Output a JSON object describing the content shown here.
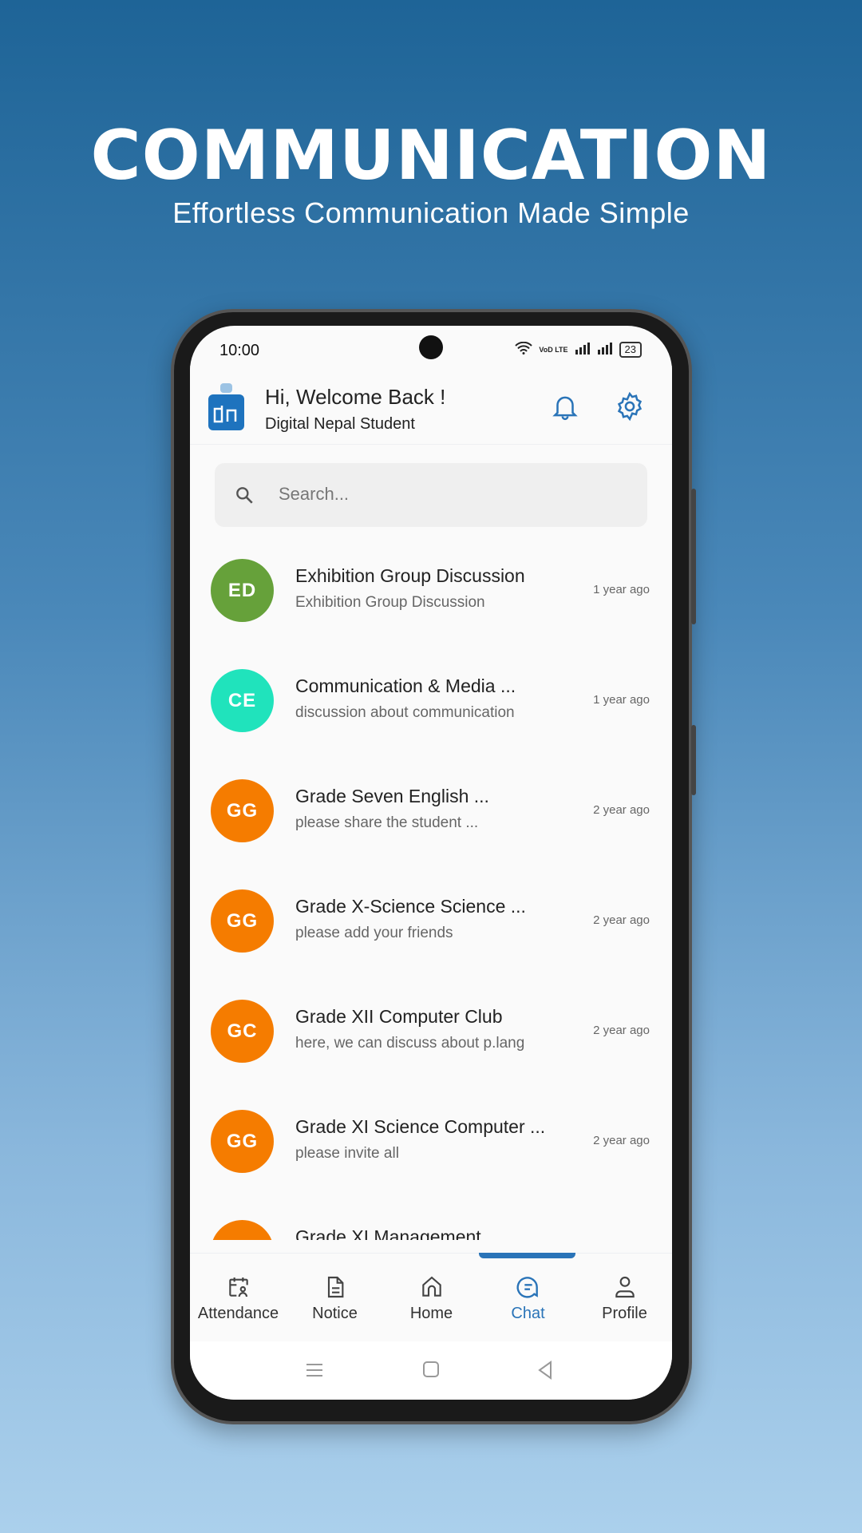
{
  "hero": {
    "title": "COMMUNICATION",
    "subtitle": "Effortless Communication Made Simple"
  },
  "status_bar": {
    "time": "10:00",
    "network": "VoD LTE",
    "battery": "23"
  },
  "header": {
    "title": "Hi, Welcome Back !",
    "subtitle": "Digital Nepal Student",
    "logo_text": "dn"
  },
  "search": {
    "placeholder": "Search..."
  },
  "chats": [
    {
      "initials": "ED",
      "title": "Exhibition Group Discussion",
      "subtitle": "Exhibition Group Discussion",
      "time": "1 year ago",
      "color": "#66a13a"
    },
    {
      "initials": "CE",
      "title": "Communication & Media ...",
      "subtitle": "discussion about communication",
      "time": "1 year ago",
      "color": "#20e3bc"
    },
    {
      "initials": "GG",
      "title": "Grade Seven English ...",
      "subtitle": "please share the student ...",
      "time": "2 year ago",
      "color": "#f57c00"
    },
    {
      "initials": "GG",
      "title": "Grade X-Science Science ...",
      "subtitle": "please add your friends",
      "time": "2 year ago",
      "color": "#f57c00"
    },
    {
      "initials": "GC",
      "title": "Grade XII Computer Club",
      "subtitle": "here, we can discuss about p.lang",
      "time": "2 year ago",
      "color": "#f57c00"
    },
    {
      "initials": "GG",
      "title": "Grade XI Science Computer ...",
      "subtitle": "please invite all",
      "time": "2 year ago",
      "color": "#f57c00"
    },
    {
      "initials": "",
      "title": "Grade XI Management",
      "subtitle": "",
      "time": "",
      "color": "#f57c00"
    }
  ],
  "nav": {
    "active": "Chat",
    "accent": "#2a74b8",
    "tabs": [
      {
        "label": "Attendance",
        "icon": "calendar-user-icon"
      },
      {
        "label": "Notice",
        "icon": "document-icon"
      },
      {
        "label": "Home",
        "icon": "home-icon"
      },
      {
        "label": "Chat",
        "icon": "chat-icon"
      },
      {
        "label": "Profile",
        "icon": "user-icon"
      }
    ]
  }
}
